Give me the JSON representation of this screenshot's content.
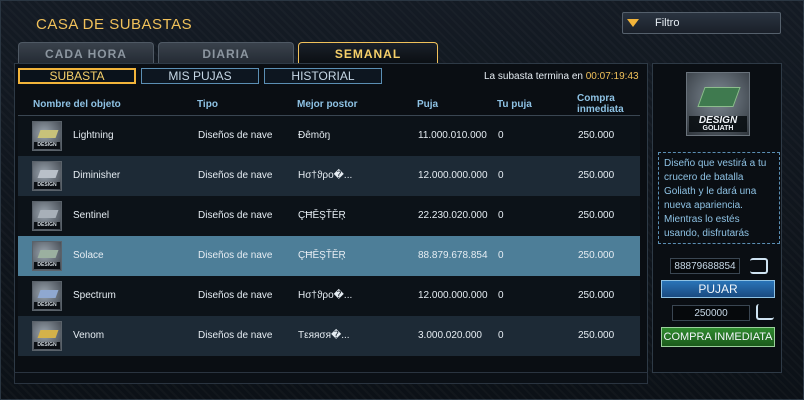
{
  "window": {
    "title": "CASA DE SUBASTAS"
  },
  "filter": {
    "label": "Filtro"
  },
  "tabs": [
    {
      "label": "CADA HORA"
    },
    {
      "label": "DIARIA"
    },
    {
      "label": "SEMANAL"
    }
  ],
  "subtabs": [
    {
      "label": "SUBASTA"
    },
    {
      "label": "MIS PUJAS"
    },
    {
      "label": "HISTORIAL"
    }
  ],
  "auction_end": {
    "label": "La subasta termina en",
    "time": "00:07:19:43"
  },
  "columns": {
    "name": "Nombre del objeto",
    "type": "Tipo",
    "best_bidder": "Mejor postor",
    "bid": "Puja",
    "your_bid": "Tu puja",
    "buy_now": "Compra inmediata"
  },
  "rows": [
    {
      "name": "Lightning",
      "type": "Diseños de nave",
      "bidder": "Đêmōŋ",
      "bid": "11.000.010.000",
      "your_bid": "0",
      "buy_now": "250.000",
      "tint": "#c8c27a"
    },
    {
      "name": "Diminisher",
      "type": "Diseños de nave",
      "bidder": "Hσ†ϑρo�...",
      "bid": "12.000.000.000",
      "your_bid": "0",
      "buy_now": "250.000",
      "tint": "#b9c0c8"
    },
    {
      "name": "Sentinel",
      "type": "Diseños de nave",
      "bidder": "ÇĦĚŞŤĚŖ",
      "bid": "22.230.020.000",
      "your_bid": "0",
      "buy_now": "250.000",
      "tint": "#a8b0b8"
    },
    {
      "name": "Solace",
      "type": "Diseños de nave",
      "bidder": "ÇĦĚŞŤĚŖ",
      "bid": "88.879.678.854",
      "your_bid": "0",
      "buy_now": "250.000",
      "tint": "#9bb0a0"
    },
    {
      "name": "Spectrum",
      "type": "Diseños de nave",
      "bidder": "Hσ†ϑρo�...",
      "bid": "12.000.000.000",
      "your_bid": "0",
      "buy_now": "250.000",
      "tint": "#8fa8d0"
    },
    {
      "name": "Venom",
      "type": "Diseños de nave",
      "bidder": "Tεяяσя�...",
      "bid": "3.000.020.000",
      "your_bid": "0",
      "buy_now": "250.000",
      "tint": "#d4b24a"
    }
  ],
  "ship_logo": "DESIGN",
  "preview": {
    "logo": "DESIGN",
    "logo_sub": "GOLIATH"
  },
  "description": "Diseño que vestirá a tu crucero de batalla Goliath y le dará una nueva apariencia. Mientras lo estés usando, disfrutarás",
  "bid_input": {
    "value": "88879688854"
  },
  "bid_button": {
    "label": "PUJAR"
  },
  "buy_input": {
    "value": "250000"
  },
  "buy_button": {
    "label": "COMPRA INMEDIATA"
  }
}
